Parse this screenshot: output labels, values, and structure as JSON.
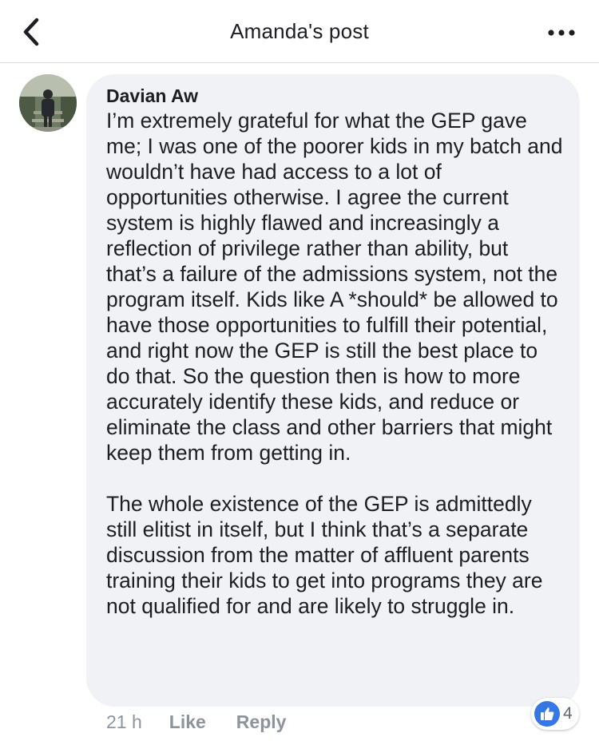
{
  "header": {
    "title": "Amanda's post",
    "back_icon": "chevron-left-icon",
    "more_icon": "more-horizontal-icon"
  },
  "comment": {
    "author": "Davian Aw",
    "paragraphs": [
      "I’m extremely grateful for what the GEP gave me; I was one of the poorer kids in my batch and wouldn’t have had access to a lot of opportunities otherwise. I agree the current system is highly flawed and increasingly a reflection of privilege rather than ability, but that’s a failure of the admissions system, not the program itself. Kids like A *should* be allowed to have those opportunities to fulfill their potential, and right now the GEP is still the best place to do that. So the question then is how to more accurately identify these kids, and reduce or eliminate the class and other barriers that might keep them from getting in.",
      "The whole existence of the GEP is admittedly still elitist in itself, but I think that’s a separate discussion from the matter of affluent parents training their kids to get into programs they are not qualified for and are likely to struggle in."
    ],
    "time": "21 h",
    "like_label": "Like",
    "reply_label": "Reply",
    "reaction_icon": "thumbs-up-icon",
    "reaction_count": "4"
  },
  "colors": {
    "bubble": "#f0f2f5",
    "divider": "#d8dadf",
    "secondary_text": "#8d949e",
    "like_blue": "#3578e5"
  }
}
